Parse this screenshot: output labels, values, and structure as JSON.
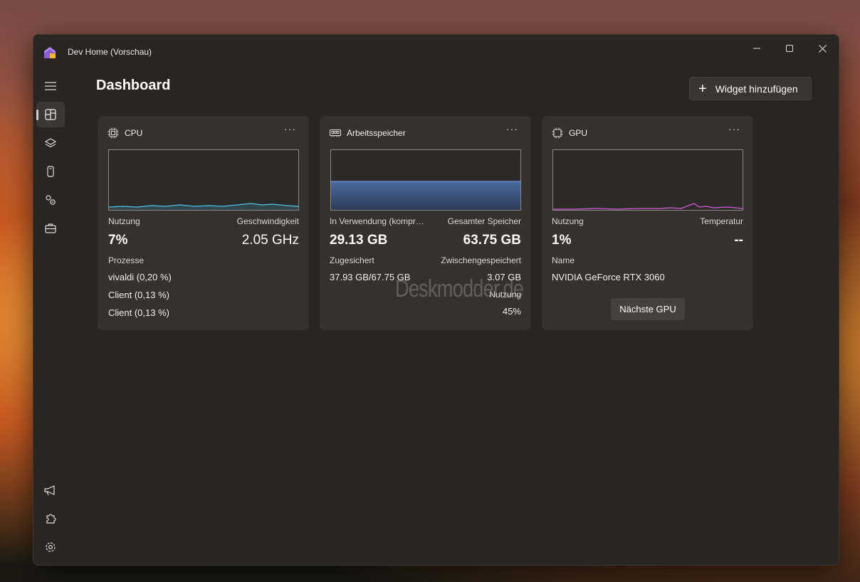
{
  "window": {
    "title": "Dev Home (Vorschau)"
  },
  "header": {
    "title": "Dashboard",
    "add_widget_label": "Widget hinzufügen"
  },
  "nav": {
    "items": [
      {
        "icon": "hamburger-menu-icon"
      },
      {
        "icon": "dashboard-icon",
        "active": true
      },
      {
        "icon": "layers-icon"
      },
      {
        "icon": "device-icon"
      },
      {
        "icon": "settings-gears-icon"
      },
      {
        "icon": "toolbox-icon"
      }
    ],
    "footer": [
      {
        "icon": "megaphone-icon"
      },
      {
        "icon": "extensions-puzzle-icon"
      },
      {
        "icon": "settings-icon"
      }
    ]
  },
  "widgets": {
    "cpu": {
      "title": "CPU",
      "usage_label": "Nutzung",
      "usage_value": "7%",
      "speed_label": "Geschwindigkeit",
      "speed_value": "2.05 GHz",
      "processes_label": "Prozesse",
      "processes": [
        "vivaldi (0,20 %)",
        "Client (0,13 %)",
        "Client (0,13 %)"
      ],
      "line_color": "#4fc3e8"
    },
    "memory": {
      "title": "Arbeitsspeicher",
      "in_use_label": "In Verwendung (kompr…",
      "in_use_value": "29.13 GB",
      "total_label": "Gesamter Speicher",
      "total_value": "63.75 GB",
      "committed_label": "Zugesichert",
      "committed_value": "37.93 GB/67.75 GB",
      "cached_label": "Zwischengespeichert",
      "cached_value": "3.07 GB",
      "usage_label": "Nutzung",
      "usage_value": "45%",
      "fill_fraction": 0.45,
      "fill_color": "#3f5c8e"
    },
    "gpu": {
      "title": "GPU",
      "usage_label": "Nutzung",
      "usage_value": "1%",
      "temp_label": "Temperatur",
      "temp_value": "--",
      "name_label": "Name",
      "name_value": "NVIDIA GeForce RTX 3060",
      "next_button": "Nächste GPU",
      "line_color": "#d25bd8"
    }
  },
  "watermark": "Deskmodder.de"
}
